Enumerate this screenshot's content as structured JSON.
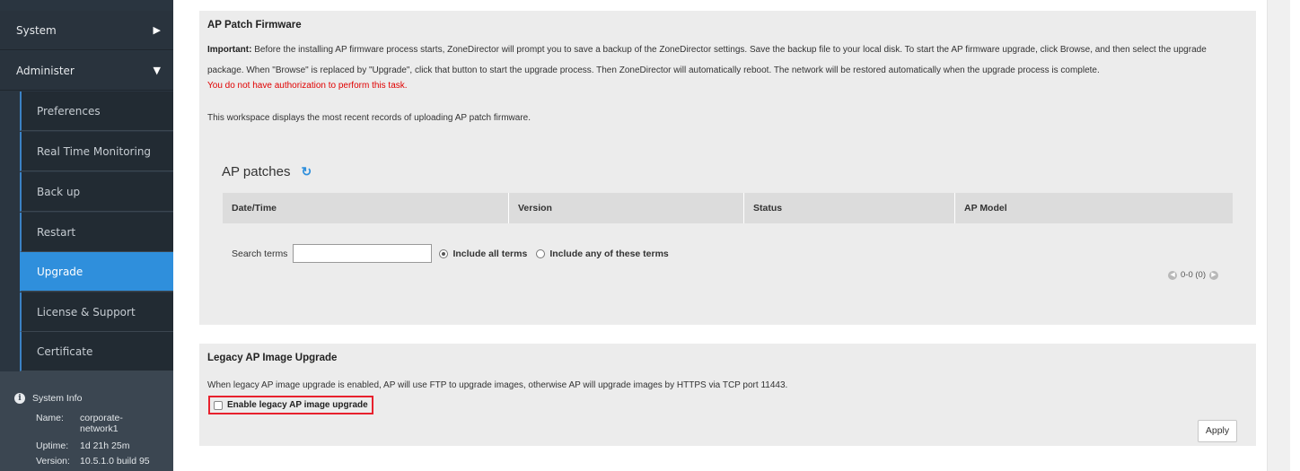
{
  "sidebar": {
    "top_items": [
      {
        "label": "System",
        "arrow": "▶"
      },
      {
        "label": "Administer",
        "arrow": "▼"
      }
    ],
    "sub_items": [
      {
        "label": "Preferences"
      },
      {
        "label": "Real Time Monitoring"
      },
      {
        "label": "Back up"
      },
      {
        "label": "Restart"
      },
      {
        "label": "Upgrade"
      },
      {
        "label": "License & Support"
      },
      {
        "label": "Certificate"
      }
    ],
    "active_item": "Upgrade",
    "system_info": {
      "title": "System Info",
      "name_label": "Name:",
      "name_value": "corporate-network1",
      "uptime_label": "Uptime:",
      "uptime_value": "1d 21h 25m",
      "version_label": "Version:",
      "version_value": "10.5.1.0 build 95"
    }
  },
  "firmware": {
    "title": "AP Patch Firmware",
    "important_label": "Important:",
    "important_line1": " Before the installing AP firmware process starts, ZoneDirector will prompt you to save a backup of the ZoneDirector settings. Save the backup file to your local disk. To start the AP firmware upgrade, click Browse, and then select the upgrade",
    "important_line2": "package. When \"Browse\" is replaced by \"Upgrade\", click that button to start the upgrade process. Then ZoneDirector will automatically reboot. The network will be restored automatically when the upgrade process is complete.",
    "no_auth": "You do not have authorization to perform this task.",
    "workspace_desc": "This workspace displays the most recent records of uploading AP patch firmware.",
    "patches_title": "AP patches",
    "refresh_icon": "↻",
    "columns": [
      "Date/Time",
      "Version",
      "Status",
      "AP Model"
    ],
    "search_label": "Search terms",
    "search_value": "",
    "option_all": "Include all terms",
    "option_any": "Include any of these terms",
    "pager_text": "0-0 (0)",
    "pager_prev": "◀",
    "pager_next": "▶"
  },
  "legacy": {
    "title": "Legacy AP Image Upgrade",
    "desc": "When legacy AP image upgrade is enabled, AP will use FTP to upgrade images, otherwise AP will upgrade images by HTTPS via TCP port 11443.",
    "checkbox_label": "Enable legacy AP image upgrade",
    "checked": false,
    "apply_label": "Apply"
  },
  "colors": {
    "sidebar_bg": "#2a3540",
    "active_bg": "#2f8fdc",
    "error_red": "#e00000",
    "highlight_border": "#e8212d"
  }
}
